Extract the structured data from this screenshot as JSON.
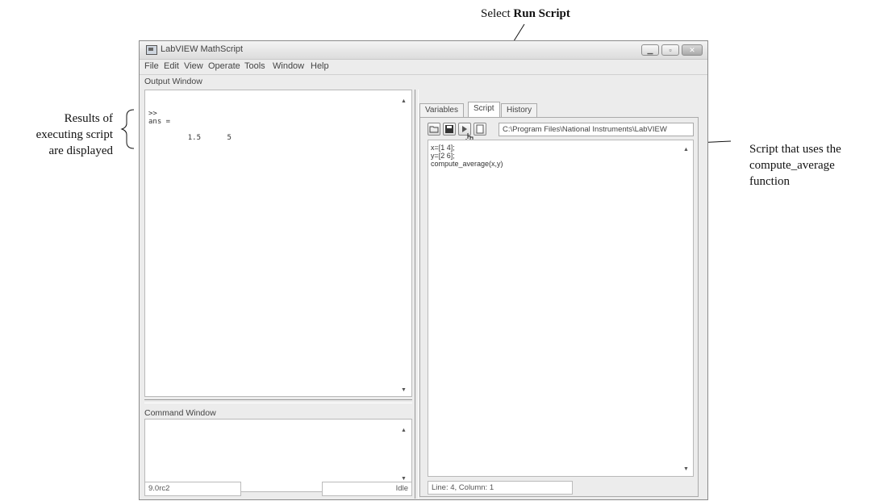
{
  "annotations": {
    "select_prefix": "Select ",
    "select_bold": "Run Script",
    "results_line1": "Results of",
    "results_line2": "executing script",
    "results_line3": "are displayed",
    "script_line1": "Script that uses the",
    "script_line2": "compute_average",
    "script_line3": "function"
  },
  "window": {
    "title": "LabVIEW MathScript",
    "menu": [
      "File",
      "Edit",
      "View",
      "Operate",
      "Tools",
      "Window",
      "Help"
    ]
  },
  "output": {
    "label": "Output Window",
    "lines": [
      ">>",
      "ans =",
      "         1.5      5"
    ]
  },
  "command": {
    "label": "Command Window"
  },
  "status": {
    "version": "9.0rc2",
    "state": "Idle"
  },
  "tabs": [
    "Variables",
    "Script",
    "History"
  ],
  "script": {
    "path": "C:\\Program Files\\National Instruments\\LabVIEW",
    "lines": [
      "x=[1 4];",
      "y=[2 6];",
      "compute_average(x,y)"
    ],
    "position": "Line: 4, Column: 1"
  }
}
